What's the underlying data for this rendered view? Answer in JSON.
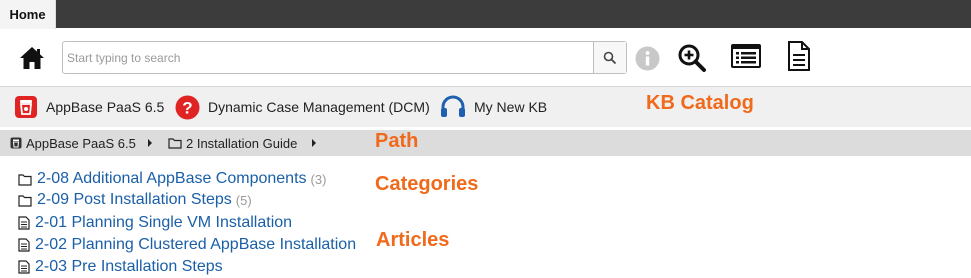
{
  "tabs": {
    "home_label": "Home"
  },
  "search": {
    "placeholder": "Start typing to search"
  },
  "kb_catalog": {
    "items": [
      {
        "label": "AppBase PaaS 6.5",
        "icon": "appbase-icon"
      },
      {
        "label": "Dynamic Case Management (DCM)",
        "icon": "question-icon"
      },
      {
        "label": "My New KB",
        "icon": "headphones-icon"
      }
    ]
  },
  "breadcrumb": [
    {
      "label": "AppBase PaaS 6.5",
      "icon": "appbase-small-icon"
    },
    {
      "label": "2 Installation Guide",
      "icon": "folder-icon"
    }
  ],
  "categories": [
    {
      "label": "2-08 Additional AppBase Components",
      "count": "(3)"
    },
    {
      "label": "2-09 Post Installation Steps",
      "count": "(5)"
    }
  ],
  "articles": [
    {
      "label": "2-01 Planning Single VM Installation"
    },
    {
      "label": "2-02 Planning Clustered AppBase Installation"
    },
    {
      "label": "2-03 Pre Installation Steps"
    }
  ],
  "annotations": {
    "kb_catalog": "KB Catalog",
    "path": "Path",
    "categories": "Categories",
    "articles": "Articles"
  },
  "colors": {
    "annotation": "#f06a1c",
    "link": "#1a5fa8",
    "appbase_red": "#e02424",
    "headphones_blue": "#1f5fb0"
  }
}
